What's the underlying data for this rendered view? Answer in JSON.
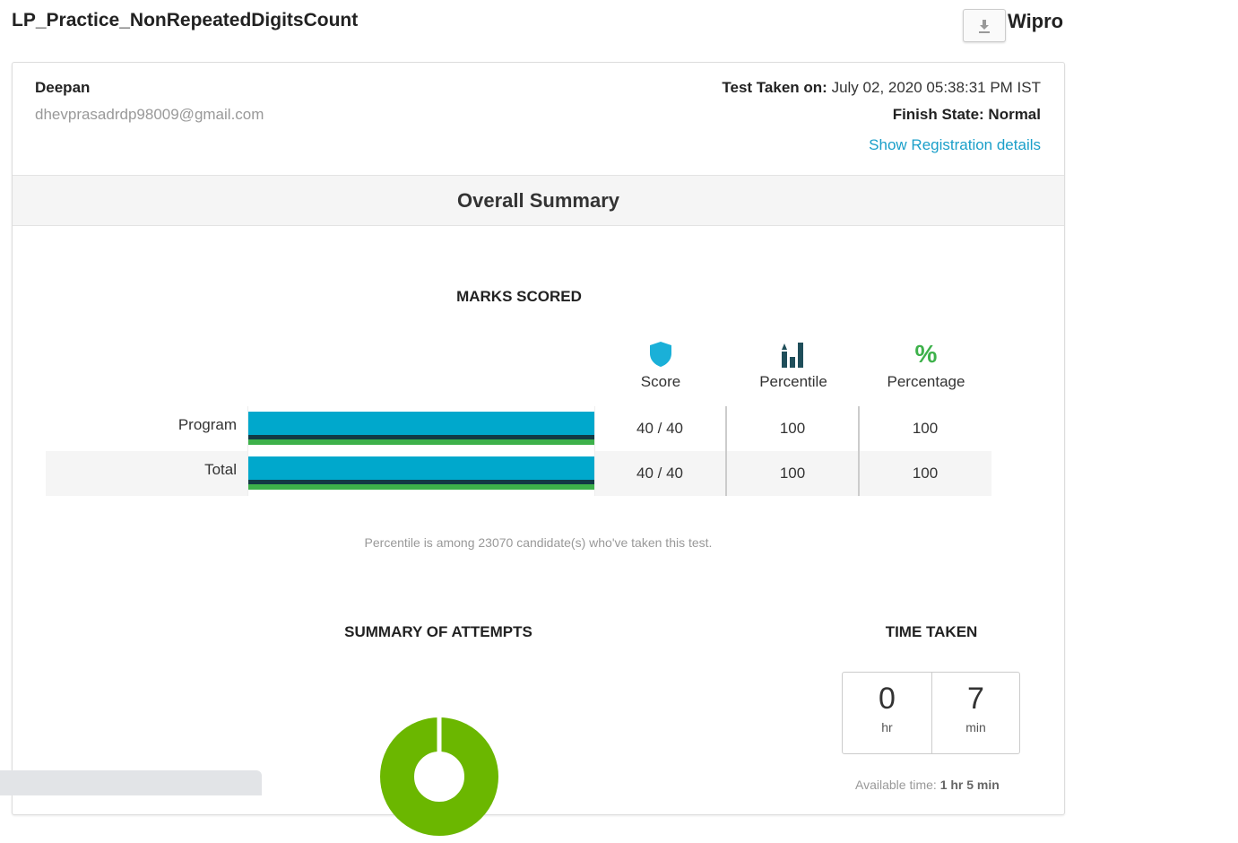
{
  "page": {
    "title": "LP_Practice_NonRepeatedDigitsCount",
    "company": "Wipro"
  },
  "header": {
    "download_icon": "download-icon"
  },
  "candidate": {
    "name": "Deepan",
    "email": "dhevprasadrdp98009@gmail.com",
    "test_taken_label": "Test Taken on:",
    "test_taken_value": "July 02, 2020 05:38:31 PM IST",
    "finish_state": "Finish State: Normal",
    "registration_link": "Show Registration details"
  },
  "summary": {
    "title": "Overall Summary",
    "marks_heading": "MARKS SCORED",
    "columns": [
      {
        "label": "Score",
        "icon": "shield-icon",
        "color": "#1ab0d8"
      },
      {
        "label": "Percentile",
        "icon": "bar-chart-up-icon",
        "color": "#1f4e5a"
      },
      {
        "label": "Percentage",
        "icon": "percent-icon",
        "symbol": "%",
        "color": "#3db14a"
      }
    ],
    "rows": [
      {
        "label": "Program",
        "score": "40 / 40",
        "percentile": "100",
        "percentage": "100",
        "bar_fraction": 1.0
      },
      {
        "label": "Total",
        "score": "40 / 40",
        "percentile": "100",
        "percentage": "100",
        "bar_fraction": 1.0
      }
    ],
    "bar_colors": {
      "score": "#00a8cc",
      "percentile": "#123a45",
      "percentage": "#3db14a"
    },
    "footnote": "Percentile is among 23070 candidate(s) who've taken this test."
  },
  "attempts": {
    "heading": "SUMMARY OF ATTEMPTS",
    "donut_color": "#6bb700"
  },
  "time_taken": {
    "heading": "TIME TAKEN",
    "hours": "0",
    "hours_unit": "hr",
    "minutes": "7",
    "minutes_unit": "min",
    "available_label": "Available time:",
    "available_value": "1 hr 5 min"
  }
}
